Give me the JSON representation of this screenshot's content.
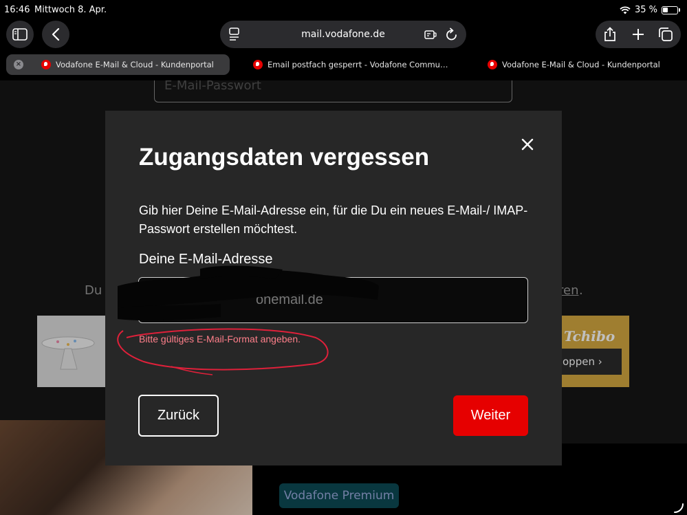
{
  "status_bar": {
    "time": "16:46",
    "date": "Mittwoch 8. Apr.",
    "battery": "35 %"
  },
  "browser": {
    "url": "mail.vodafone.de",
    "tabs": [
      {
        "title": "Vodafone E-Mail & Cloud - Kundenportal",
        "active": true
      },
      {
        "title": "Email postfach gesperrt - Vodafone Commu…",
        "active": false
      },
      {
        "title": "Vodafone E-Mail & Cloud - Kundenportal",
        "active": false
      }
    ]
  },
  "background": {
    "password_placeholder": "E-Mail-Passwort",
    "text_left": "Du",
    "text_right": "ren",
    "text_right_suffix": ".",
    "promo_brand": "Tchibo",
    "promo_cta": "oppen",
    "premium_label": "Vodafone Premium"
  },
  "modal": {
    "title": "Zugangsdaten vergessen",
    "description": "Gib hier Deine E-Mail-Adresse ein, für die Du ein neues E-Mail-/ IMAP-Passwort erstellen möchtest.",
    "email_label": "Deine E-Mail-Adresse",
    "email_value": "onemail.de",
    "error_text": "Bitte gültiges E-Mail-Format angeben.",
    "back_label": "Zurück",
    "next_label": "Weiter"
  },
  "colors": {
    "accent": "#e60000",
    "error": "#ff7f8a",
    "modal_bg": "#272727"
  }
}
